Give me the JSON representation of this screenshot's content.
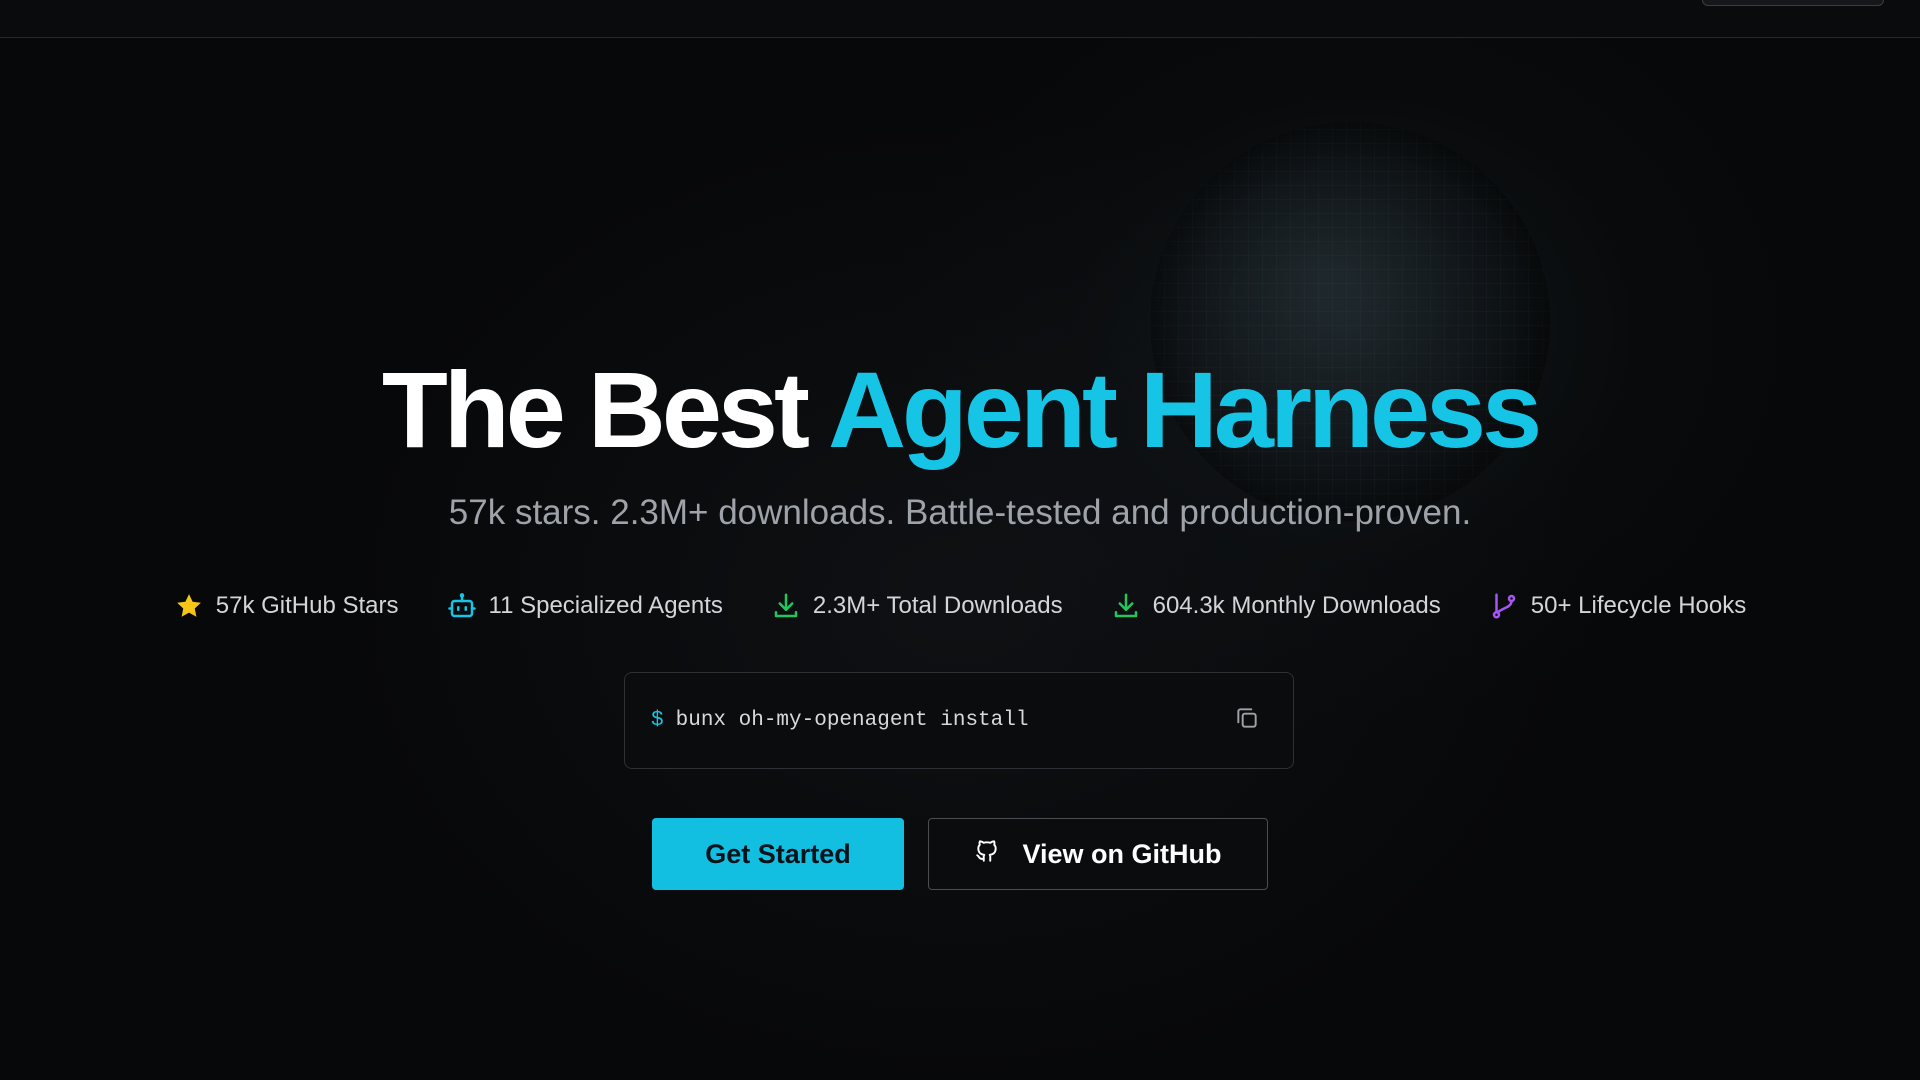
{
  "hero": {
    "title_white": "The Best",
    "title_accent": "Agent Harness",
    "subtitle": "57k stars. 2.3M+ downloads. Battle-tested and production-proven."
  },
  "stats": [
    {
      "icon": "star-icon",
      "label": "57k GitHub Stars",
      "color": "#f5c518"
    },
    {
      "icon": "robot-icon",
      "label": "11 Specialized Agents",
      "color": "#16c4e6"
    },
    {
      "icon": "download-icon",
      "label": "2.3M+ Total Downloads",
      "color": "#22c55e"
    },
    {
      "icon": "download-icon",
      "label": "604.3k Monthly Downloads",
      "color": "#22c55e"
    },
    {
      "icon": "git-branch-icon",
      "label": "50+ Lifecycle Hooks",
      "color": "#a855f7"
    }
  ],
  "install": {
    "prompt": "$",
    "command": "bunx oh-my-openagent install"
  },
  "actions": {
    "primary_label": "Get Started",
    "secondary_label": "View on GitHub"
  },
  "colors": {
    "accent": "#16c4e6",
    "background": "#070809"
  }
}
